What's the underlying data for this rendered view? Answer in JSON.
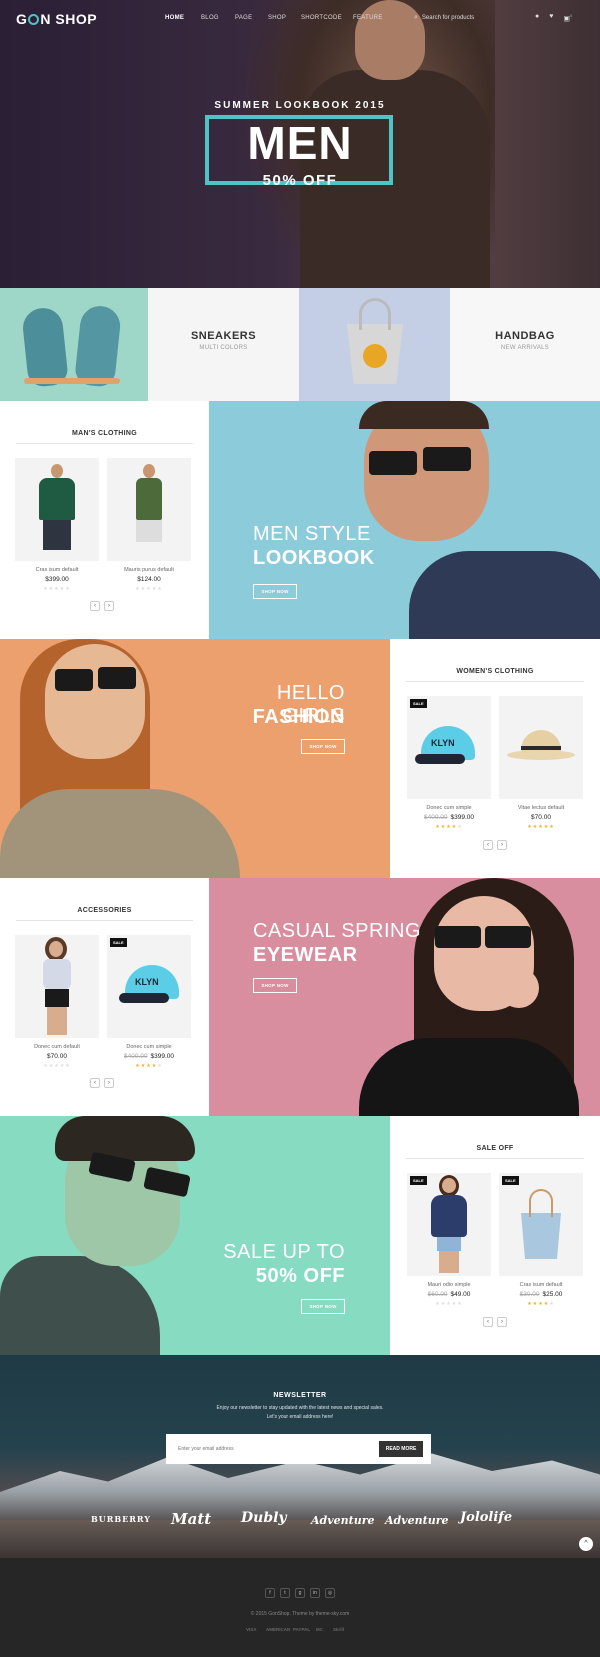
{
  "header": {
    "logo_before": "G",
    "logo_after": "N SHOP",
    "nav": [
      "HOME",
      "BLOG",
      "PAGE",
      "SHOP",
      "SHORTCODE",
      "FEATURE"
    ],
    "search_placeholder": "Search for products",
    "cart_count": "0"
  },
  "hero": {
    "subtitle": "SUMMER LOOKBOOK 2015",
    "title": "MEN",
    "offer": "50% OFF"
  },
  "categories": [
    {
      "title": "SNEAKERS",
      "subtitle": "MULTI COLORS"
    },
    {
      "title": "HANDBAG",
      "subtitle": "NEW ARRIVALS"
    }
  ],
  "mens": {
    "title": "MAN'S CLOTHING",
    "products": [
      {
        "name": "Cras isum default",
        "price": "$399.00"
      },
      {
        "name": "Mauris purus default",
        "price": "$124.00"
      }
    ],
    "banner_line1": "MEN STYLE",
    "banner_line2": "LOOKBOOK",
    "button": "SHOP NOW"
  },
  "girls": {
    "banner_line1": "HELLO GIRLS",
    "banner_line2": "FASHION",
    "button": "SHOP NOW",
    "title": "WOMEN'S CLOTHING",
    "products": [
      {
        "badge": "SALE",
        "name": "Donec cum simple",
        "old_price": "$400.00",
        "price": "$399.00"
      },
      {
        "name": "Vitae lectus default",
        "price": "$70.00"
      }
    ]
  },
  "accessories": {
    "title": "ACCESSORIES",
    "products": [
      {
        "name": "Donec cum default",
        "price": "$70.00"
      },
      {
        "badge": "SALE",
        "name": "Donec cum simple",
        "old_price": "$400.00",
        "price": "$399.00"
      }
    ],
    "banner_line1": "CASUAL SPRING",
    "banner_line2": "EYEWEAR",
    "button": "SHOP NOW"
  },
  "sale": {
    "banner_line1": "SALE UP TO",
    "banner_line2": "50% OFF",
    "button": "SHOP NOW",
    "title": "SALE OFF",
    "products": [
      {
        "badge": "SALE",
        "name": "Mauri odio simple",
        "old_price": "$60.00",
        "price": "$49.00"
      },
      {
        "badge": "SALE",
        "name": "Cras isum default",
        "old_price": "$30.00",
        "price": "$25.00"
      }
    ]
  },
  "newsletter": {
    "title": "NEWSLETTER",
    "desc_line1": "Enjoy our newsletter to stay updated with the latest news and special sales.",
    "desc_line2": "Let's your email address here!",
    "placeholder": "Enter your email address",
    "button": "READ MORE"
  },
  "brands": [
    "BURBERRY",
    "Matt",
    "Dubly",
    "Adventure",
    "Adventure",
    "Jololife"
  ],
  "footer": {
    "copyright": "© 2015 GonShop. Theme by theme-sky.com",
    "payments": [
      "VISA",
      "AMERICAN",
      "PAYPAL",
      "MC",
      "Skrill"
    ]
  },
  "colors": {
    "accent": "#4fc3c6",
    "mint": "#9ed6c8",
    "sky": "#8ccbd9",
    "peach": "#eba06e",
    "rose": "#d88e9e",
    "aqua": "#86dbc0",
    "rating": "#f2b01e"
  }
}
